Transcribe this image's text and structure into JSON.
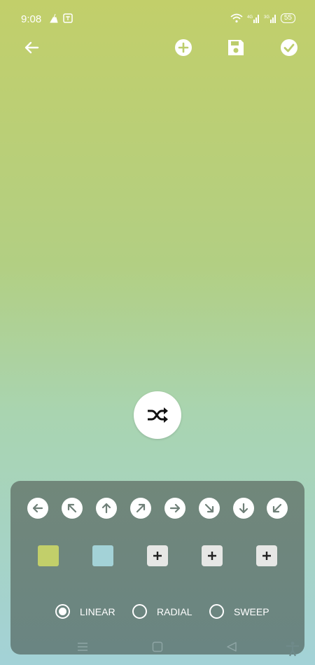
{
  "status_bar": {
    "time": "9:08",
    "battery": "55"
  },
  "toolbar": {
    "back_icon": "arrow-left-icon",
    "add_icon": "plus-circle-icon",
    "save_icon": "floppy-disk-icon",
    "confirm_icon": "check-circle-icon"
  },
  "shuffle": {
    "icon": "shuffle-icon"
  },
  "directions": [
    "left",
    "up-left",
    "up",
    "up-right",
    "right",
    "down-right",
    "down",
    "down-left"
  ],
  "colors": {
    "swatches": [
      "#c2cf6a",
      "#a3d2d7"
    ],
    "add_slots": 3,
    "background_top": "#c2cf6a",
    "background_bottom": "#a3d2d7"
  },
  "gradient_types": [
    {
      "label": "LINEAR",
      "selected": true
    },
    {
      "label": "RADIAL",
      "selected": false
    },
    {
      "label": "SWEEP",
      "selected": false
    }
  ]
}
